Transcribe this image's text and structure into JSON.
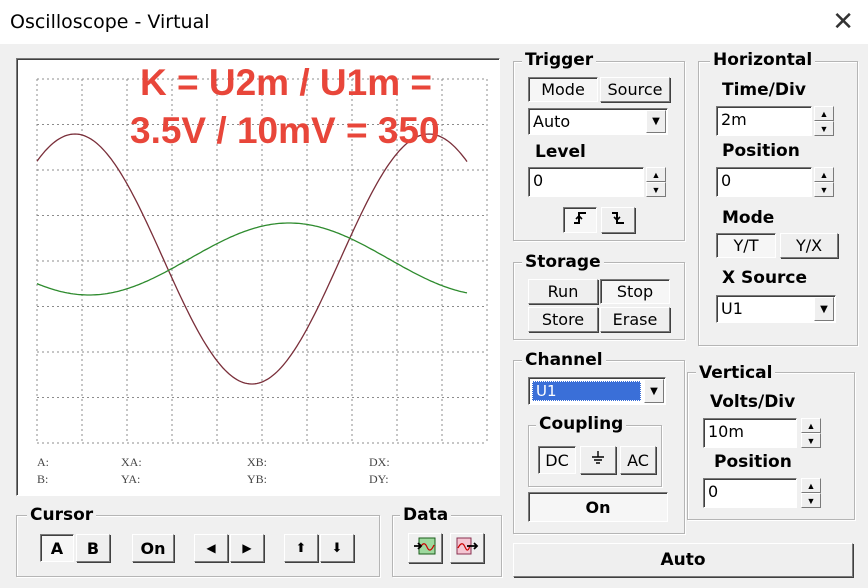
{
  "window": {
    "title": "Oscilloscope - Virtual",
    "close_glyph": "✕"
  },
  "annotation": {
    "line1": "K = U2m / U1m =",
    "line2": "3.5V / 10mV = 350",
    "color": "#e8463a"
  },
  "trace_colors": {
    "channel_a": "#7a2f3a",
    "channel_b": "#2e8b2e"
  },
  "cursor_readouts": {
    "a": "A:",
    "b": "B:",
    "xa": "XA:",
    "ya": "YA:",
    "xb": "XB:",
    "yb": "YB:",
    "dx": "DX:",
    "dy": "DY:"
  },
  "trigger": {
    "title": "Trigger",
    "mode_tab": "Mode",
    "source_tab": "Source",
    "mode_value": "Auto",
    "level_label": "Level",
    "level_value": "0",
    "rising_edge_glyph": "⨍",
    "falling_edge_glyph": "ꝭ"
  },
  "horizontal": {
    "title": "Horizontal",
    "time_div_label": "Time/Div",
    "time_div_value": "2m",
    "position_label": "Position",
    "position_value": "0",
    "mode_label": "Mode",
    "yt_label": "Y/T",
    "yx_label": "Y/X",
    "xsource_label": "X Source",
    "xsource_value": "U1"
  },
  "storage": {
    "title": "Storage",
    "run": "Run",
    "stop": "Stop",
    "store": "Store",
    "erase": "Erase"
  },
  "channel": {
    "title": "Channel",
    "value": "U1",
    "coupling_title": "Coupling",
    "dc": "DC",
    "gnd_glyph": "⏚",
    "ac": "AC",
    "on_label": "On"
  },
  "vertical": {
    "title": "Vertical",
    "volts_div_label": "Volts/Div",
    "volts_div_value": "10m",
    "position_label": "Position",
    "position_value": "0"
  },
  "cursor": {
    "title": "Cursor",
    "a": "A",
    "b": "B",
    "on": "On",
    "left": "◀",
    "right": "▶",
    "up": "⬆",
    "down": "⬇"
  },
  "data_group": {
    "title": "Data"
  },
  "auto_button": "Auto"
}
